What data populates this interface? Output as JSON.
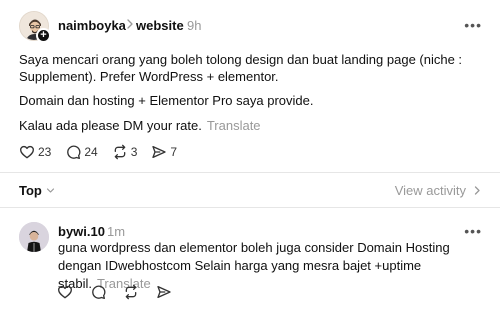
{
  "post": {
    "author": "naimboyka",
    "topic": "website",
    "time": "9h",
    "paragraphs": [
      "Saya mencari orang yang boleh tolong design dan buat landing page (niche : Supplement). Prefer WordPress + elementor.",
      "Domain dan hosting + Elementor Pro saya provide.",
      "Kalau ada please DM your rate."
    ],
    "translate_label": "Translate",
    "more_label": "•••",
    "follow_badge": "+",
    "actions": {
      "likes": "23",
      "replies": "24",
      "reposts": "3",
      "shares": "7"
    }
  },
  "sort": {
    "label": "Top",
    "view_activity": "View activity"
  },
  "reply": {
    "author": "bywi.10",
    "time": "1m",
    "text": "guna wordpress dan elementor boleh juga consider Domain Hosting dengan IDwebhostcom Selain harga yang mesra bajet +uptime stabil.",
    "translate_label": "Translate",
    "more_label": "•••"
  },
  "icons": {
    "follow": "plus-icon",
    "like": "heart-icon",
    "reply": "comment-bubble-icon",
    "repost": "repost-icon",
    "share": "send-icon",
    "chevron": "chevron-icon"
  }
}
